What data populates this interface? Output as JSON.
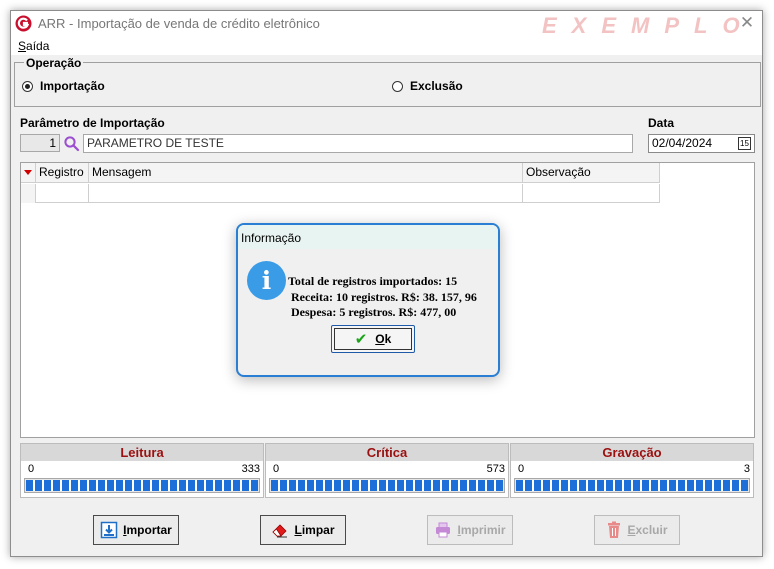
{
  "window": {
    "title": "ARR - Importação de venda de crédito eletrônico",
    "watermark": "EXEMPLO"
  },
  "menu": {
    "saida_prefix": "S",
    "saida_rest": "aída"
  },
  "operacao": {
    "label": "Operação",
    "options": [
      {
        "label": "Importação",
        "selected": true
      },
      {
        "label": "Exclusão",
        "selected": false
      }
    ]
  },
  "parametro": {
    "label": "Parâmetro de Importação",
    "code": "1",
    "value": "PARAMETRO DE TESTE"
  },
  "data": {
    "label": "Data",
    "value": "02/04/2024",
    "calendar_day": "15"
  },
  "grid": {
    "columns": [
      "Registro",
      "Mensagem",
      "Observação"
    ]
  },
  "dialog": {
    "title": "Informação",
    "lines": [
      "Total de registros importados: 15",
      "Receita: 10 registros. R$: 38. 157, 96",
      "Despesa: 5 registros. R$: 477, 00"
    ],
    "ok_prefix": "O",
    "ok_rest": "k"
  },
  "progress": [
    {
      "label": "Leitura",
      "min": "0",
      "max": "333",
      "fraction": 1.0
    },
    {
      "label": "Crítica",
      "min": "0",
      "max": "573",
      "fraction": 1.0
    },
    {
      "label": "Gravação",
      "min": "0",
      "max": "3",
      "fraction": 1.0
    }
  ],
  "buttons": {
    "importar": {
      "prefix": "I",
      "rest": "mportar",
      "icon": "import-icon"
    },
    "limpar": {
      "prefix": "L",
      "rest": "impar",
      "icon": "eraser-icon"
    },
    "imprimir": {
      "prefix": "I",
      "rest": "mprimir",
      "icon": "printer-icon"
    },
    "excluir": {
      "prefix": "E",
      "rest": "xcluir",
      "icon": "trash-icon"
    }
  },
  "colors": {
    "accent": "#2a7fd4",
    "progress_fill": "#1c6fd8",
    "section_label": "#9b1010",
    "watermark": "#f3c2c2"
  }
}
